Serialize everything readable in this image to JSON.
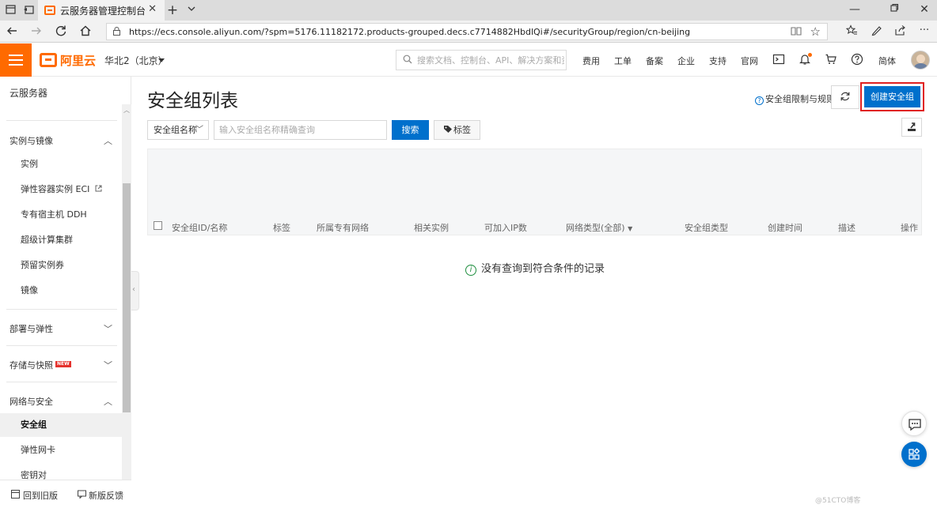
{
  "browser": {
    "tab_title": "云服务器管理控制台",
    "new_tab": "+",
    "url": "https://ecs.console.aliyun.com/?spm=5176.11182172.products-grouped.decs.c7714882HbdlQi#/securityGroup/region/cn-beijing"
  },
  "console": {
    "logo_text": "阿里云",
    "region": "华北2（北京）",
    "search_placeholder": "搜索文档、控制台、API、解决方案和资源",
    "nav_links": [
      "费用",
      "工单",
      "备案",
      "企业",
      "支持",
      "官网"
    ],
    "language": "简体"
  },
  "sidebar": {
    "title": "云服务器",
    "groups": {
      "instances": "实例与镜像",
      "deploy": "部署与弹性",
      "storage": "存储与快照",
      "network": "网络与安全"
    },
    "new_badge": "NEW",
    "items": {
      "instance": "实例",
      "eci": "弹性容器实例 ECI",
      "ddh": "专有宿主机 DDH",
      "super": "超级计算集群",
      "reserved": "预留实例券",
      "image": "镜像",
      "security_group": "安全组",
      "eni": "弹性网卡",
      "keypair": "密钥对"
    },
    "footer": {
      "old": "回到旧版",
      "feedback": "新版反馈"
    }
  },
  "main": {
    "title": "安全组列表",
    "help_link": "安全组限制与规则",
    "create_button": "创建安全组",
    "filter_select": "安全组名称",
    "filter_placeholder": "输入安全组名称精确查询",
    "search_button": "搜索",
    "tag_button": "标签",
    "columns": [
      "安全组ID/名称",
      "标签",
      "所属专有网络",
      "相关实例",
      "可加入IP数",
      "网络类型(全部)",
      "安全组类型",
      "创建时间",
      "描述",
      "操作"
    ],
    "empty_message": "没有查询到符合条件的记录"
  },
  "watermark": "@51CTO博客",
  "colors": {
    "brand_orange": "#ff6a00",
    "primary_blue": "#0070cc",
    "highlight_red": "#e02020"
  }
}
